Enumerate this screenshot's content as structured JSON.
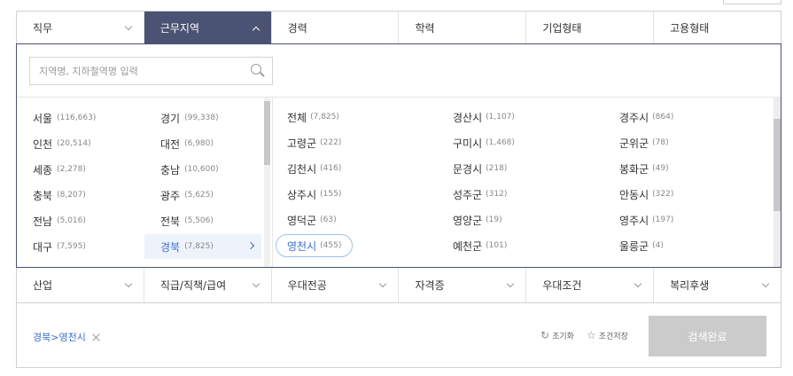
{
  "top_tabs": [
    {
      "label": "직무"
    },
    {
      "label": "근무지역"
    },
    {
      "label": "경력"
    },
    {
      "label": "학력"
    },
    {
      "label": "기업형태"
    },
    {
      "label": "고용형태"
    }
  ],
  "search": {
    "placeholder": "지역명, 지하철역명 입력",
    "value": ""
  },
  "regions": [
    {
      "name": "서울",
      "count": "(116,663)"
    },
    {
      "name": "경기",
      "count": "(99,338)"
    },
    {
      "name": "인천",
      "count": "(20,514)"
    },
    {
      "name": "대전",
      "count": "(6,980)"
    },
    {
      "name": "세종",
      "count": "(2,278)"
    },
    {
      "name": "충남",
      "count": "(10,600)"
    },
    {
      "name": "충북",
      "count": "(8,207)"
    },
    {
      "name": "광주",
      "count": "(5,625)"
    },
    {
      "name": "전남",
      "count": "(5,016)"
    },
    {
      "name": "전북",
      "count": "(5,506)"
    },
    {
      "name": "대구",
      "count": "(7,595)"
    },
    {
      "name": "경북",
      "count": "(7,825)"
    }
  ],
  "selected_region": "경북",
  "cities": [
    {
      "name": "전체",
      "count": "(7,825)"
    },
    {
      "name": "경산시",
      "count": "(1,107)"
    },
    {
      "name": "경주시",
      "count": "(864)"
    },
    {
      "name": "고령군",
      "count": "(222)"
    },
    {
      "name": "구미시",
      "count": "(1,468)"
    },
    {
      "name": "군위군",
      "count": "(78)"
    },
    {
      "name": "김천시",
      "count": "(416)"
    },
    {
      "name": "문경시",
      "count": "(218)"
    },
    {
      "name": "봉화군",
      "count": "(49)"
    },
    {
      "name": "상주시",
      "count": "(155)"
    },
    {
      "name": "성주군",
      "count": "(312)"
    },
    {
      "name": "안동시",
      "count": "(322)"
    },
    {
      "name": "영덕군",
      "count": "(63)"
    },
    {
      "name": "영양군",
      "count": "(19)"
    },
    {
      "name": "영주시",
      "count": "(197)"
    },
    {
      "name": "영천시",
      "count": "(455)"
    },
    {
      "name": "예천군",
      "count": "(101)"
    },
    {
      "name": "울릉군",
      "count": "(4)"
    }
  ],
  "selected_city": "영천시",
  "bottom_tabs": [
    {
      "label": "산업"
    },
    {
      "label": "직급/직책/급여"
    },
    {
      "label": "우대전공"
    },
    {
      "label": "자격증"
    },
    {
      "label": "우대조건"
    },
    {
      "label": "복리후생"
    }
  ],
  "footer": {
    "selected_chip": "경북>영천시",
    "reset_label": "초기화",
    "save_label": "조건저장",
    "submit_label": "검색완료"
  },
  "colors": {
    "active_tab": "#4a5373",
    "accent": "#3b6fd1",
    "submit_disabled": "#cbcbcb"
  }
}
